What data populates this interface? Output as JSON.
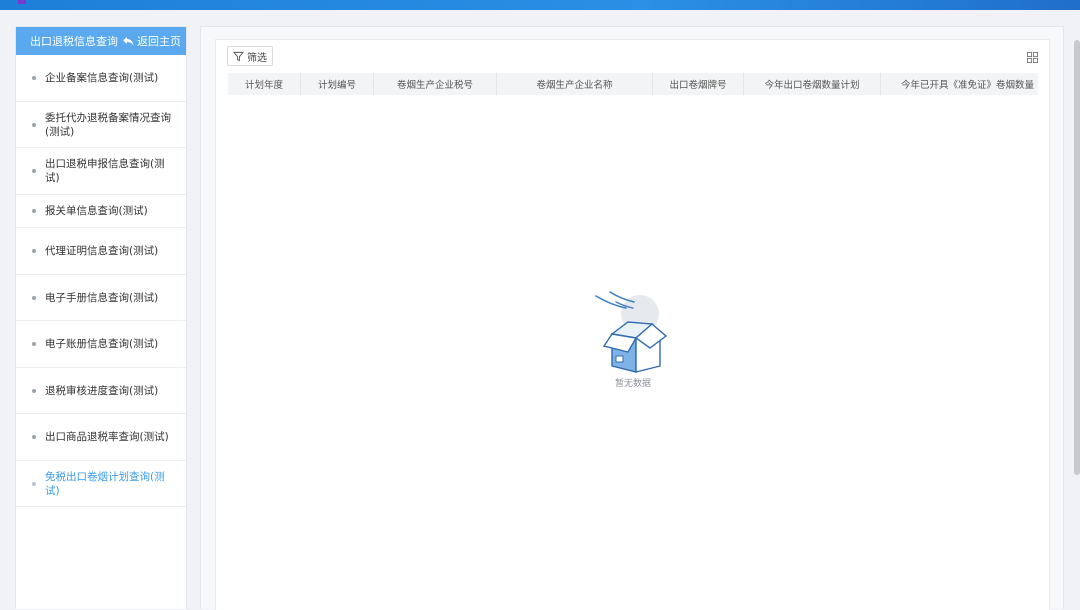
{
  "sidebar": {
    "header_title": "出口退税信息查询",
    "back_label": "返回主页",
    "items": [
      {
        "label": "企业备案信息查询(测试)",
        "active": false
      },
      {
        "label": "委托代办退税备案情况查询(测试)",
        "active": false
      },
      {
        "label": "出口退税申报信息查询(测试)",
        "active": false
      },
      {
        "label": "报关单信息查询(测试)",
        "active": false
      },
      {
        "label": "代理证明信息查询(测试)",
        "active": false
      },
      {
        "label": "电子手册信息查询(测试)",
        "active": false
      },
      {
        "label": "电子账册信息查询(测试)",
        "active": false
      },
      {
        "label": "退税审核进度查询(测试)",
        "active": false
      },
      {
        "label": "出口商品退税率查询(测试)",
        "active": false
      },
      {
        "label": "免税出口卷烟计划查询(测试)",
        "active": true
      }
    ]
  },
  "toolbar": {
    "filter_label": "筛选",
    "filter_icon": "funnel-icon",
    "columns_icon": "grid-icon"
  },
  "table": {
    "columns": [
      "计划年度",
      "计划编号",
      "卷烟生产企业税号",
      "卷烟生产企业名称",
      "出口卷烟牌号",
      "今年出口卷烟数量计划",
      "今年已开具《准免证》卷烟数量"
    ],
    "rows": []
  },
  "empty_state": {
    "text": "暂无数据",
    "icon": "empty-box-icon"
  },
  "colors": {
    "top_bar": "#1e7fd8",
    "sidebar_header": "#5aa9ee",
    "active_item": "#3a9be8"
  }
}
